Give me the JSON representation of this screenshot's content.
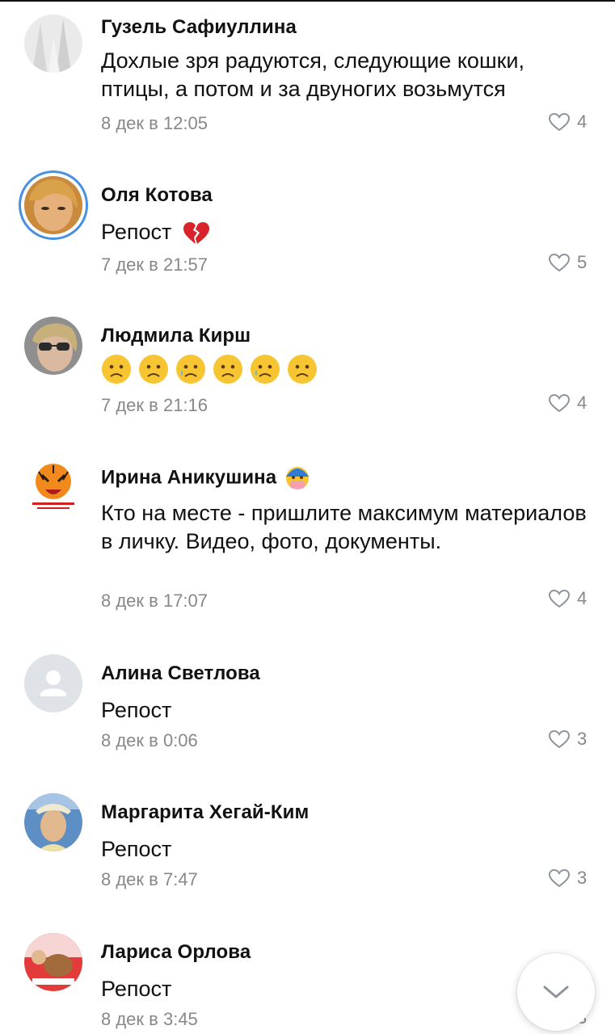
{
  "comments": [
    {
      "author": "Гузель Сафиуллина",
      "text": "Дохлые зря радуются, следующие кошки, птицы, а потом и за двуногих возьмутся",
      "date": "8 дек в 12:05",
      "likes": "4"
    },
    {
      "author": "Оля Котова",
      "text": "Репост",
      "date": "7 дек в 21:57",
      "likes": "5"
    },
    {
      "author": "Людмила Кирш",
      "text": "",
      "date": "7 дек в 21:16",
      "likes": "4"
    },
    {
      "author": "Ирина Аникушина",
      "text": "Кто на месте - пришлите максимум материалов в личку. Видео, фото, документы.",
      "date": "8 дек в 17:07",
      "likes": "4"
    },
    {
      "author": "Алина Светлова",
      "text": "Репост",
      "date": "8 дек в 0:06",
      "likes": "3"
    },
    {
      "author": "Маргарита Хегай-Ким",
      "text": "Репост",
      "date": "8 дек в 7:47",
      "likes": "3"
    },
    {
      "author": "Лариса Орлова",
      "text": "Репост",
      "date": "8 дек в 3:45",
      "likes": "3"
    }
  ],
  "icons": {
    "like": "heart-outline-icon",
    "scroll": "chevron-down-icon"
  },
  "colors": {
    "meta": "#888888",
    "ring": "#4a90e2"
  }
}
